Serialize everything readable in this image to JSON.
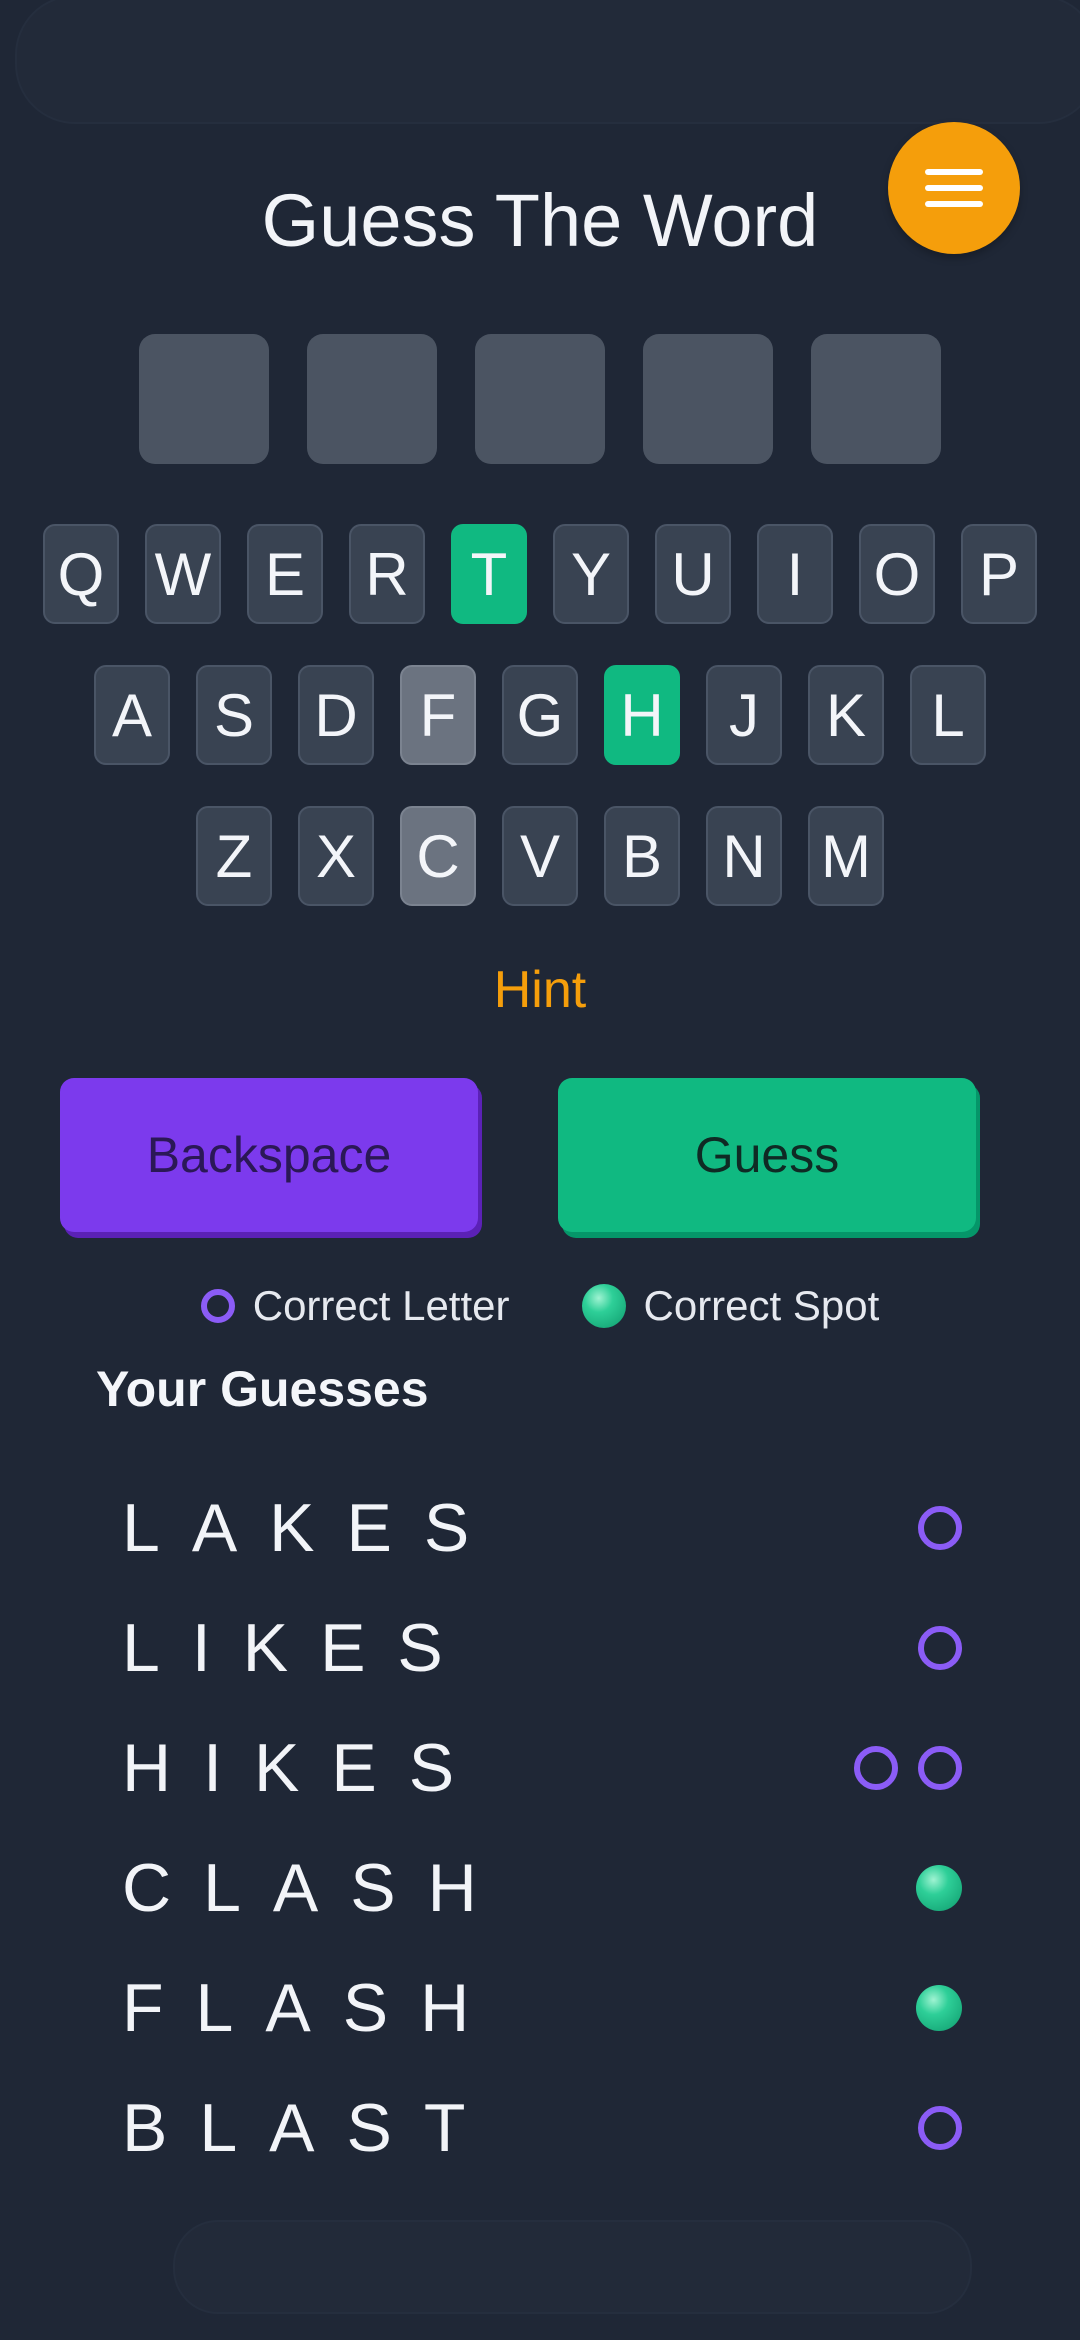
{
  "title": "Guess The Word",
  "menu": {
    "icon": "hamburger-menu-icon"
  },
  "slots": [
    "",
    "",
    "",
    "",
    ""
  ],
  "keyboard": {
    "rows": [
      [
        {
          "k": "Q",
          "s": "default"
        },
        {
          "k": "W",
          "s": "default"
        },
        {
          "k": "E",
          "s": "default"
        },
        {
          "k": "R",
          "s": "default"
        },
        {
          "k": "T",
          "s": "correct"
        },
        {
          "k": "Y",
          "s": "default"
        },
        {
          "k": "U",
          "s": "default"
        },
        {
          "k": "I",
          "s": "default"
        },
        {
          "k": "O",
          "s": "default"
        },
        {
          "k": "P",
          "s": "default"
        }
      ],
      [
        {
          "k": "A",
          "s": "default"
        },
        {
          "k": "S",
          "s": "default"
        },
        {
          "k": "D",
          "s": "default"
        },
        {
          "k": "F",
          "s": "used"
        },
        {
          "k": "G",
          "s": "default"
        },
        {
          "k": "H",
          "s": "correct"
        },
        {
          "k": "J",
          "s": "default"
        },
        {
          "k": "K",
          "s": "default"
        },
        {
          "k": "L",
          "s": "default"
        }
      ],
      [
        {
          "k": "Z",
          "s": "default"
        },
        {
          "k": "X",
          "s": "default"
        },
        {
          "k": "C",
          "s": "used"
        },
        {
          "k": "V",
          "s": "default"
        },
        {
          "k": "B",
          "s": "default"
        },
        {
          "k": "N",
          "s": "default"
        },
        {
          "k": "M",
          "s": "default"
        }
      ]
    ]
  },
  "hint_label": "Hint",
  "buttons": {
    "backspace": "Backspace",
    "guess": "Guess"
  },
  "legend": {
    "correct_letter": "Correct Letter",
    "correct_spot": "Correct Spot"
  },
  "guesses_title": "Your Guesses",
  "guesses": [
    {
      "word": "LAKES",
      "markers": [
        "ring"
      ]
    },
    {
      "word": "LIKES",
      "markers": [
        "ring"
      ]
    },
    {
      "word": "HIKES",
      "markers": [
        "ring",
        "ring"
      ]
    },
    {
      "word": "CLASH",
      "markers": [
        "dot"
      ]
    },
    {
      "word": "FLASH",
      "markers": [
        "dot"
      ]
    },
    {
      "word": "BLAST",
      "markers": [
        "ring"
      ]
    }
  ],
  "colors": {
    "background": "#1f2736",
    "accent_orange": "#f59e0b",
    "correct_green": "#10b981",
    "letter_purple": "#8b5cf6",
    "backspace_purple": "#7c3aed",
    "used_gray": "#6b7380"
  }
}
